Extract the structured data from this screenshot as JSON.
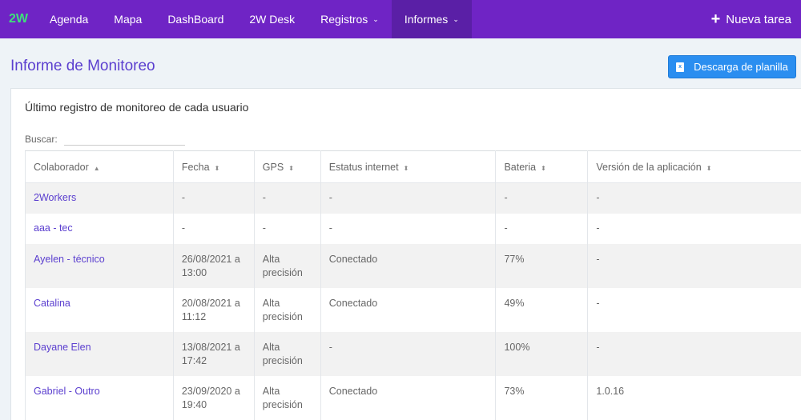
{
  "nav": {
    "brand": "2W",
    "items": [
      {
        "label": "Agenda",
        "caret": ""
      },
      {
        "label": "Mapa",
        "caret": ""
      },
      {
        "label": "DashBoard",
        "caret": ""
      },
      {
        "label": "2W Desk",
        "caret": ""
      },
      {
        "label": "Registros",
        "caret": "⌄"
      },
      {
        "label": "Informes",
        "caret": "⌄",
        "active": true
      }
    ],
    "new_task": "Nueva tarea"
  },
  "page": {
    "title": "Informe de Monitoreo",
    "download_button": "Descarga de planilla"
  },
  "card": {
    "title": "Último registro de monitoreo de cada usuario",
    "search_label": "Buscar:",
    "search_value": ""
  },
  "table": {
    "headers": [
      "Colaborador",
      "Fecha",
      "GPS",
      "Estatus internet",
      "Bateria",
      "Versión de la aplicación"
    ],
    "rows": [
      [
        "2Workers",
        "-",
        "-",
        "-",
        "-",
        "-"
      ],
      [
        "aaa - tec",
        "-",
        "-",
        "-",
        "-",
        "-"
      ],
      [
        "Ayelen - técnico",
        "26/08/2021 a 13:00",
        "Alta precisión",
        "Conectado",
        "77%",
        "-"
      ],
      [
        "Catalina",
        "20/08/2021 a 11:12",
        "Alta precisión",
        "Conectado",
        "49%",
        "-"
      ],
      [
        "Dayane Elen",
        "13/08/2021 a 17:42",
        "Alta precisión",
        "-",
        "100%",
        "-"
      ],
      [
        "Gabriel - Outro",
        "23/09/2020 a 19:40",
        "Alta precisión",
        "Conectado",
        "73%",
        "1.0.16"
      ]
    ]
  }
}
